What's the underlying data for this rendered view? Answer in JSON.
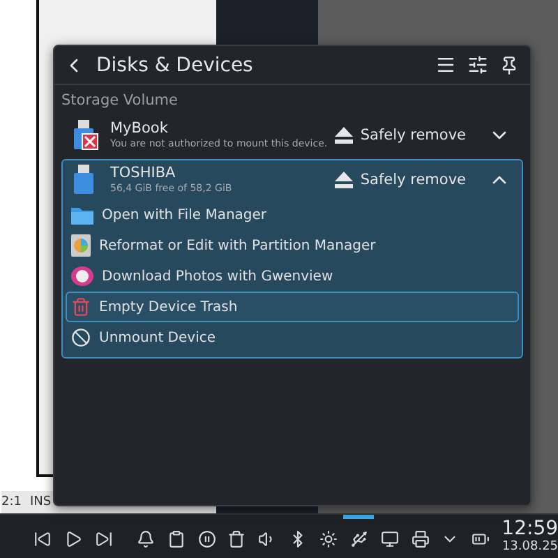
{
  "header": {
    "title": "Disks & Devices"
  },
  "section": "Storage Volume",
  "devices": [
    {
      "name": "MyBook",
      "detail": "You are not authorized to mount this device.",
      "action": "Safely remove",
      "expanded": false,
      "selected": false,
      "error": true
    },
    {
      "name": "TOSHIBA",
      "detail": "56,4 GiB free of 58,2 GiB",
      "action": "Safely remove",
      "expanded": true,
      "selected": true,
      "error": false,
      "actions": [
        {
          "kind": "folder",
          "label": "Open with File Manager",
          "selected": false
        },
        {
          "kind": "partition",
          "label": "Reformat or Edit with Partition Manager",
          "selected": false
        },
        {
          "kind": "photos",
          "label": "Download Photos with Gwenview",
          "selected": false
        },
        {
          "kind": "trash",
          "label": "Empty Device Trash",
          "selected": true
        },
        {
          "kind": "unmount",
          "label": "Unmount Device",
          "selected": false
        }
      ]
    }
  ],
  "editor_status": [
    "2:1",
    "INS"
  ],
  "taskbar": {
    "items": [
      {
        "kind": "previous",
        "active": false
      },
      {
        "kind": "play",
        "active": false
      },
      {
        "kind": "next",
        "active": false
      },
      {
        "kind": "bell",
        "active": false
      },
      {
        "kind": "clipboard",
        "active": false
      },
      {
        "kind": "pause",
        "active": false
      },
      {
        "kind": "trash",
        "active": false
      },
      {
        "kind": "volume",
        "active": false
      },
      {
        "kind": "bluetooth",
        "active": false
      },
      {
        "kind": "brightness",
        "active": false
      },
      {
        "kind": "usb",
        "active": true
      },
      {
        "kind": "network",
        "active": false
      },
      {
        "kind": "printer",
        "active": false
      },
      {
        "kind": "expand",
        "active": false
      },
      {
        "kind": "battery",
        "active": false
      }
    ],
    "clock": {
      "time": "12:59",
      "date": "13.08.25"
    }
  }
}
